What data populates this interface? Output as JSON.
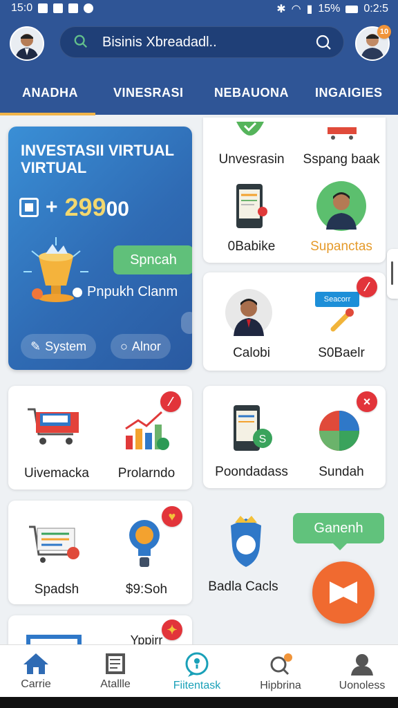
{
  "status": {
    "time": "15:0",
    "battery": "15%",
    "clock": "0:2:5"
  },
  "search": {
    "text": "Bisinis Xbreadadl.."
  },
  "header": {
    "tabs": [
      "ANADHA",
      "VINESRASI",
      "NEBAUONA",
      "INGAIGIES"
    ],
    "profile_badge": "10"
  },
  "promo": {
    "title": "INVESTASII VIRTUAL VIRTUAL",
    "amount_prefix": "+",
    "amount_highlight": "299",
    "amount_suffix": "00",
    "spn_button": "Spncah",
    "description": "Pnpukh Clanm",
    "button_system": "System",
    "button_alnor": "Alnor"
  },
  "cards": {
    "c1": [
      "Unvesrasin",
      "Sspang baak"
    ],
    "c2": [
      "0Babike",
      "Supanctas"
    ],
    "c3": [
      "Calobi",
      "S0Baelr"
    ],
    "c3_tag": "Seacorr",
    "c4": [
      "Uivemacka",
      "Prolarndo"
    ],
    "c5": [
      "Poondadass",
      "Sundah"
    ],
    "c6": [
      "Spadsh",
      "$9:Soh"
    ],
    "c7": "Badla Cacls",
    "c8": "Yppirr"
  },
  "tooltip": "Ganenh",
  "nav": [
    "Carrie",
    "Atallle",
    "Fiitentask",
    "Hipbrina",
    "Uonoless"
  ],
  "colors": {
    "header": "#2f5596",
    "accent": "#f0b449",
    "green": "#60c07a",
    "fab": "#f06a30",
    "active_nav": "#19a0b8"
  }
}
